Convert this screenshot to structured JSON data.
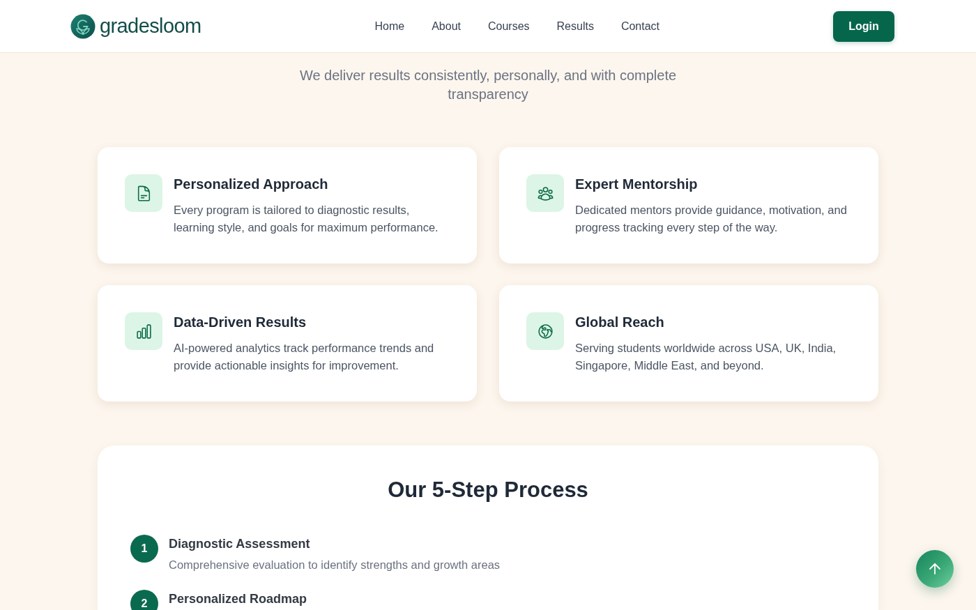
{
  "header": {
    "logo_text": "gradesloom",
    "nav": [
      {
        "label": "Home"
      },
      {
        "label": "About"
      },
      {
        "label": "Courses"
      },
      {
        "label": "Results"
      },
      {
        "label": "Contact"
      }
    ],
    "login_button": "Login"
  },
  "intro": {
    "subtitle": "We deliver results consistently, personally, and with complete transparency"
  },
  "features": [
    {
      "kind": "document",
      "title": "Personalized Approach",
      "description": "Every program is tailored to diagnostic results, learning style, and goals for maximum performance."
    },
    {
      "kind": "people",
      "title": "Expert Mentorship",
      "description": "Dedicated mentors provide guidance, motivation, and progress tracking every step of the way."
    },
    {
      "kind": "chart",
      "title": "Data-Driven Results",
      "description": "AI-powered analytics track performance trends and provide actionable insights for improvement."
    },
    {
      "kind": "globe",
      "title": "Global Reach",
      "description": "Serving students worldwide across USA, UK, India, Singapore, Middle East, and beyond."
    }
  ],
  "process": {
    "title": "Our 5-Step Process",
    "steps": [
      {
        "number": "1",
        "title": "Diagnostic Assessment",
        "description": "Comprehensive evaluation to identify strengths and growth areas"
      },
      {
        "number": "2",
        "title": "Personalized Roadmap"
      }
    ]
  }
}
